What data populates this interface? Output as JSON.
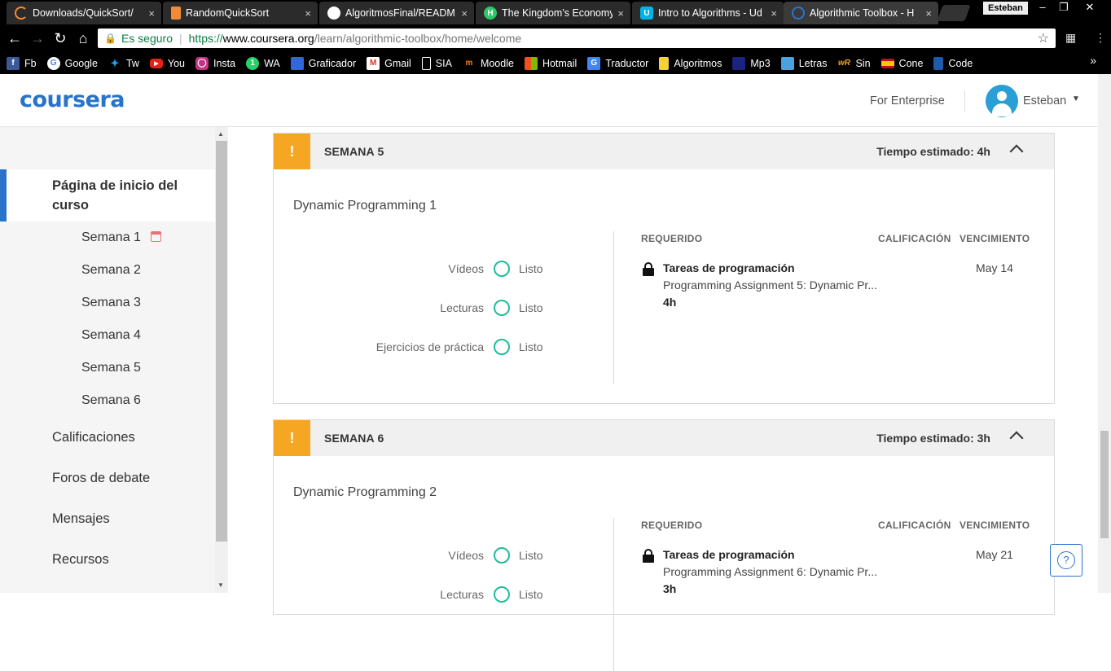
{
  "browser": {
    "tabs": [
      {
        "title": "Downloads/QuickSort/",
        "icon": "loading-icon",
        "color": "#f28b36"
      },
      {
        "title": "RandomQuickSort",
        "icon": "book-icon",
        "color": "#f28b36"
      },
      {
        "title": "AlgoritmosFinal/READM",
        "icon": "github-icon",
        "color": "#ffffff"
      },
      {
        "title": "The Kingdom's Economy",
        "icon": "hackerrank-icon",
        "color": "#2ec866"
      },
      {
        "title": "Intro to Algorithms - Ud",
        "icon": "udacity-icon",
        "color": "#02b3e4"
      },
      {
        "title": "Algorithmic Toolbox - H",
        "icon": "coursera-icon",
        "color": "#2a73cc"
      }
    ],
    "close_glyph": "×",
    "profile_name": "Esteban",
    "secure_label": "Es seguro",
    "url_scheme": "https://",
    "url_host": "www.coursera.org",
    "url_path": "/learn/algorithmic-toolbox/home/welcome",
    "bookmarks": [
      {
        "label": "Fb",
        "icon": "facebook-icon",
        "color": "#3b5998"
      },
      {
        "label": "Google",
        "icon": "google-icon",
        "color": "#ffffff"
      },
      {
        "label": "Tw",
        "icon": "twitter-icon",
        "color": "#1da1f2"
      },
      {
        "label": "You",
        "icon": "youtube-icon",
        "color": "#e62117"
      },
      {
        "label": "Insta",
        "icon": "instagram-icon",
        "color": "#c13584"
      },
      {
        "label": "WA",
        "icon": "whatsapp-icon",
        "color": "#25d366"
      },
      {
        "label": "Graficador",
        "icon": "grapher-icon",
        "color": "#3367d6"
      },
      {
        "label": "Gmail",
        "icon": "gmail-icon",
        "color": "#d93025"
      },
      {
        "label": "SIA",
        "icon": "page-icon",
        "color": "#000000"
      },
      {
        "label": "Moodle",
        "icon": "moodle-icon",
        "color": "#f98012"
      },
      {
        "label": "Hotmail",
        "icon": "windows-icon",
        "color": "#f25022"
      },
      {
        "label": "Traductor",
        "icon": "translate-icon",
        "color": "#4285f4"
      },
      {
        "label": "Algoritmos",
        "icon": "folder-icon",
        "color": "#f4d03f"
      },
      {
        "label": "Mp3",
        "icon": "mp3-icon",
        "color": "#1a237e"
      },
      {
        "label": "Letras",
        "icon": "lyrics-icon",
        "color": "#4aa3df"
      },
      {
        "label": "Sin",
        "icon": "wordreference-icon",
        "color": "#f5a623"
      },
      {
        "label": "Cone",
        "icon": "spain-flag-icon",
        "color": "#c60b1e"
      },
      {
        "label": "Code",
        "icon": "code-icon",
        "color": "#1e5aa8"
      }
    ]
  },
  "header": {
    "logo": "coursera",
    "for_enterprise": "For Enterprise",
    "user_name": "Esteban"
  },
  "sidebar": {
    "active_item": "Página de inicio del curso",
    "weeks": [
      "Semana 1",
      "Semana 2",
      "Semana 3",
      "Semana 4",
      "Semana 5",
      "Semana 6"
    ],
    "main_items": [
      "Calificaciones",
      "Foros de debate",
      "Mensajes",
      "Recursos"
    ]
  },
  "weeks": [
    {
      "title": "SEMANA 5",
      "estimated_time": "Tiempo estimado: 4h",
      "module_title": "Dynamic Programming 1",
      "progress": [
        {
          "label": "Vídeos",
          "status": "Listo"
        },
        {
          "label": "Lecturas",
          "status": "Listo"
        },
        {
          "label": "Ejercicios de práctica",
          "status": "Listo"
        }
      ],
      "columns": {
        "required": "REQUERIDO",
        "grade": "CALIFICACIÓN",
        "due": "VENCIMIENTO"
      },
      "assignment": {
        "type": "Tareas de programación",
        "name": "Programming Assignment 5: Dynamic Pr...",
        "hours": "4h",
        "due": "May 14"
      }
    },
    {
      "title": "SEMANA 6",
      "estimated_time": "Tiempo estimado: 3h",
      "module_title": "Dynamic Programming 2",
      "progress": [
        {
          "label": "Vídeos",
          "status": "Listo"
        },
        {
          "label": "Lecturas",
          "status": "Listo"
        }
      ],
      "columns": {
        "required": "REQUERIDO",
        "grade": "CALIFICACIÓN",
        "due": "VENCIMIENTO"
      },
      "assignment": {
        "type": "Tareas de programación",
        "name": "Programming Assignment 6: Dynamic Pr...",
        "hours": "3h",
        "due": "May 21"
      }
    }
  ],
  "colors": {
    "brand_blue": "#2a73cc",
    "warning_orange": "#f5a623",
    "complete_teal": "#1fbc9c"
  },
  "help_glyph": "?"
}
